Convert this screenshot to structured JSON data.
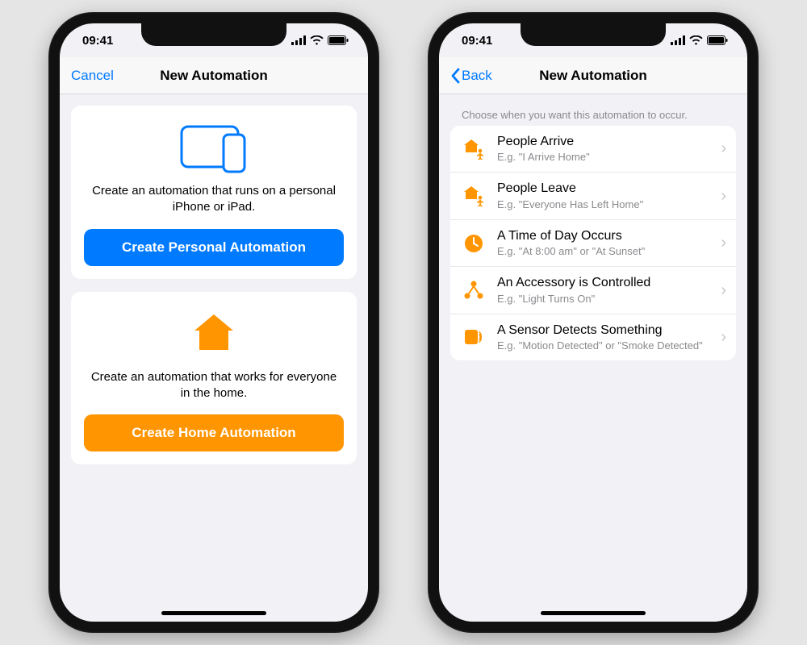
{
  "status": {
    "time": "09:41"
  },
  "colors": {
    "blue": "#007aff",
    "orange": "#ff9500",
    "gray": "#8a8a8e"
  },
  "left": {
    "nav": {
      "cancel": "Cancel",
      "title": "New Automation"
    },
    "personal": {
      "desc": "Create an automation that runs on a personal iPhone or iPad.",
      "button": "Create Personal Automation"
    },
    "home": {
      "desc": "Create an automation that works for everyone in the home.",
      "button": "Create Home Automation"
    }
  },
  "right": {
    "nav": {
      "back": "Back",
      "title": "New Automation"
    },
    "header": "Choose when you want this automation to occur.",
    "rows": [
      {
        "title": "People Arrive",
        "sub": "E.g. \"I Arrive Home\""
      },
      {
        "title": "People Leave",
        "sub": "E.g. \"Everyone Has Left Home\""
      },
      {
        "title": "A Time of Day Occurs",
        "sub": "E.g. \"At 8:00 am\" or \"At Sunset\""
      },
      {
        "title": "An Accessory is Controlled",
        "sub": "E.g. \"Light Turns On\""
      },
      {
        "title": "A Sensor Detects Something",
        "sub": "E.g. \"Motion Detected\" or \"Smoke Detected\""
      }
    ]
  }
}
